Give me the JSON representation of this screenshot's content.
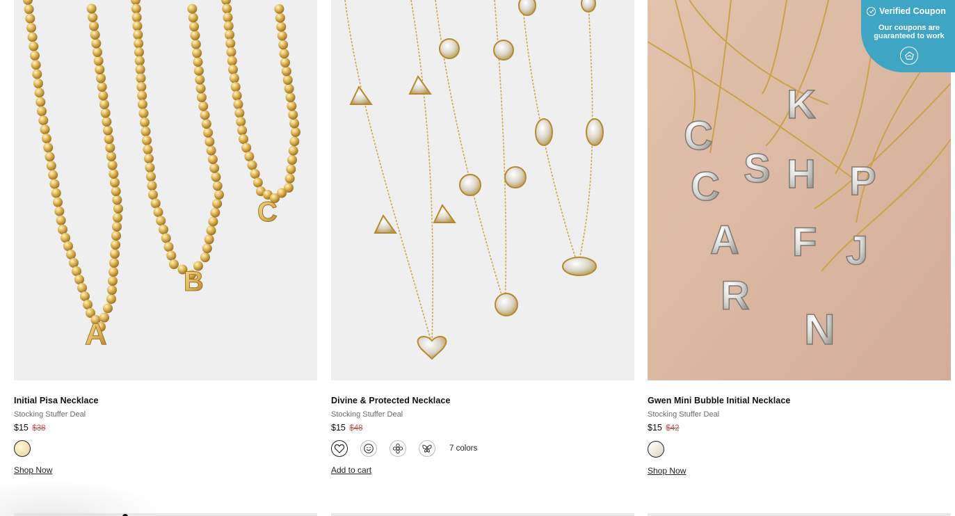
{
  "badge": {
    "title": "Verified Coupon",
    "text": "Our coupons are guaranteed to work",
    "color": "#3ea6c4"
  },
  "products": [
    {
      "title": "Initial Pisa Necklace",
      "subtitle": "Stocking Stuffer Deal",
      "price": "$15",
      "was_price": "$38",
      "swatches": [
        "gold"
      ],
      "action_label": "Shop Now",
      "image_letters": [
        "A",
        "B",
        "C"
      ]
    },
    {
      "title": "Divine & Protected Necklace",
      "subtitle": "Stocking Stuffer Deal",
      "price": "$15",
      "was_price": "$48",
      "swatches": [
        "heart-icon",
        "smiley-icon",
        "flower-icon",
        "butterfly-icon"
      ],
      "colors_count": "7 colors",
      "action_label": "Add to cart"
    },
    {
      "title": "Gwen Mini Bubble Initial Necklace",
      "subtitle": "Stocking Stuffer Deal",
      "price": "$15",
      "was_price": "$42",
      "swatches": [
        "silver"
      ],
      "action_label": "Shop Now"
    }
  ]
}
